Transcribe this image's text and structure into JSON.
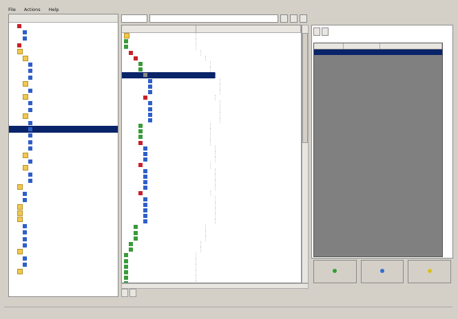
{
  "menu": [
    "File",
    "Actions",
    "Help"
  ],
  "left_header": "",
  "left_tree": [
    {
      "label": "",
      "icon": "red",
      "indent": 1
    },
    {
      "label": "",
      "icon": "blue",
      "indent": 2
    },
    {
      "label": "",
      "icon": "blue",
      "indent": 2
    },
    {
      "label": "",
      "icon": "red",
      "indent": 1
    },
    {
      "label": "",
      "icon": "folder",
      "indent": 1
    },
    {
      "label": "",
      "icon": "folder",
      "indent": 2
    },
    {
      "label": "",
      "icon": "blue",
      "indent": 3
    },
    {
      "label": "",
      "icon": "blue",
      "indent": 3
    },
    {
      "label": "",
      "icon": "blue",
      "indent": 3
    },
    {
      "label": "",
      "icon": "folder",
      "indent": 2
    },
    {
      "label": "",
      "icon": "blue",
      "indent": 3
    },
    {
      "label": "",
      "icon": "folder",
      "indent": 2
    },
    {
      "label": "",
      "icon": "blue",
      "indent": 3
    },
    {
      "label": "",
      "icon": "blue",
      "indent": 3
    },
    {
      "label": "",
      "icon": "folder",
      "indent": 2
    },
    {
      "label": "",
      "icon": "blue",
      "indent": 3
    },
    {
      "label": "",
      "icon": "blue",
      "indent": 3,
      "selected": true
    },
    {
      "label": "",
      "icon": "blue",
      "indent": 3
    },
    {
      "label": "",
      "icon": "blue",
      "indent": 3
    },
    {
      "label": "",
      "icon": "blue",
      "indent": 3
    },
    {
      "label": "",
      "icon": "folder",
      "indent": 2
    },
    {
      "label": "",
      "icon": "blue",
      "indent": 3
    },
    {
      "label": "",
      "icon": "folder",
      "indent": 2
    },
    {
      "label": "",
      "icon": "blue",
      "indent": 3
    },
    {
      "label": "",
      "icon": "blue",
      "indent": 3
    },
    {
      "label": "",
      "icon": "folder",
      "indent": 1
    },
    {
      "label": "",
      "icon": "blue",
      "indent": 2
    },
    {
      "label": "",
      "icon": "blue",
      "indent": 2
    },
    {
      "label": "",
      "icon": "folder",
      "indent": 1
    },
    {
      "label": "",
      "icon": "folder",
      "indent": 1
    },
    {
      "label": "",
      "icon": "folder",
      "indent": 1
    },
    {
      "label": "",
      "icon": "blue",
      "indent": 2
    },
    {
      "label": "",
      "icon": "blue",
      "indent": 2
    },
    {
      "label": "",
      "icon": "blue",
      "indent": 2
    },
    {
      "label": "",
      "icon": "blue",
      "indent": 2
    },
    {
      "label": "",
      "icon": "folder",
      "indent": 1
    },
    {
      "label": "",
      "icon": "blue",
      "indent": 2
    },
    {
      "label": "",
      "icon": "blue",
      "indent": 2
    },
    {
      "label": "",
      "icon": "folder",
      "indent": 1
    }
  ],
  "mid_toolbar": {
    "combo": "",
    "buttons": [
      "",
      "",
      ""
    ]
  },
  "mid_columns": [
    "",
    ""
  ],
  "mid_rows": [
    {
      "c1": "",
      "c2": "",
      "indent": 0,
      "icon": "folder"
    },
    {
      "c1": "",
      "c2": "",
      "indent": 0,
      "icon": "green"
    },
    {
      "c1": "",
      "c2": "",
      "indent": 0,
      "icon": "green"
    },
    {
      "c1": "",
      "c2": "",
      "indent": 1,
      "icon": "red"
    },
    {
      "c1": "",
      "c2": "",
      "indent": 2,
      "icon": "red"
    },
    {
      "c1": "",
      "c2": "",
      "indent": 3,
      "icon": "green"
    },
    {
      "c1": "",
      "c2": "",
      "indent": 3,
      "icon": "green"
    },
    {
      "c1": "",
      "c2": "",
      "indent": 4,
      "icon": "gray",
      "selected": true
    },
    {
      "c1": "",
      "c2": "",
      "indent": 5,
      "icon": "blue"
    },
    {
      "c1": "",
      "c2": "",
      "indent": 5,
      "icon": "blue"
    },
    {
      "c1": "",
      "c2": "",
      "indent": 5,
      "icon": "blue"
    },
    {
      "c1": "",
      "c2": "",
      "indent": 4,
      "icon": "red"
    },
    {
      "c1": "",
      "c2": "",
      "indent": 5,
      "icon": "blue"
    },
    {
      "c1": "",
      "c2": "",
      "indent": 5,
      "icon": "blue"
    },
    {
      "c1": "",
      "c2": "",
      "indent": 5,
      "icon": "blue"
    },
    {
      "c1": "",
      "c2": "",
      "indent": 5,
      "icon": "blue"
    },
    {
      "c1": "",
      "c2": "",
      "indent": 3,
      "icon": "green"
    },
    {
      "c1": "",
      "c2": "",
      "indent": 3,
      "icon": "green"
    },
    {
      "c1": "",
      "c2": "",
      "indent": 3,
      "icon": "green"
    },
    {
      "c1": "",
      "c2": "",
      "indent": 3,
      "icon": "red"
    },
    {
      "c1": "",
      "c2": "",
      "indent": 4,
      "icon": "blue"
    },
    {
      "c1": "",
      "c2": "",
      "indent": 4,
      "icon": "blue"
    },
    {
      "c1": "",
      "c2": "",
      "indent": 4,
      "icon": "blue"
    },
    {
      "c1": "",
      "c2": "",
      "indent": 3,
      "icon": "red"
    },
    {
      "c1": "",
      "c2": "",
      "indent": 4,
      "icon": "blue"
    },
    {
      "c1": "",
      "c2": "",
      "indent": 4,
      "icon": "blue"
    },
    {
      "c1": "",
      "c2": "",
      "indent": 4,
      "icon": "blue"
    },
    {
      "c1": "",
      "c2": "",
      "indent": 4,
      "icon": "blue"
    },
    {
      "c1": "",
      "c2": "",
      "indent": 3,
      "icon": "red"
    },
    {
      "c1": "",
      "c2": "",
      "indent": 4,
      "icon": "blue"
    },
    {
      "c1": "",
      "c2": "",
      "indent": 4,
      "icon": "blue"
    },
    {
      "c1": "",
      "c2": "",
      "indent": 4,
      "icon": "blue"
    },
    {
      "c1": "",
      "c2": "",
      "indent": 4,
      "icon": "blue"
    },
    {
      "c1": "",
      "c2": "",
      "indent": 4,
      "icon": "blue"
    },
    {
      "c1": "",
      "c2": "",
      "indent": 2,
      "icon": "green"
    },
    {
      "c1": "",
      "c2": "",
      "indent": 2,
      "icon": "green"
    },
    {
      "c1": "",
      "c2": "",
      "indent": 2,
      "icon": "green"
    },
    {
      "c1": "",
      "c2": "",
      "indent": 1,
      "icon": "green"
    },
    {
      "c1": "",
      "c2": "",
      "indent": 1,
      "icon": "green"
    },
    {
      "c1": "",
      "c2": "",
      "indent": 0,
      "icon": "green"
    },
    {
      "c1": "",
      "c2": "",
      "indent": 0,
      "icon": "green"
    },
    {
      "c1": "",
      "c2": "",
      "indent": 0,
      "icon": "green"
    },
    {
      "c1": "",
      "c2": "",
      "indent": 0,
      "icon": "green"
    },
    {
      "c1": "",
      "c2": "",
      "indent": 0,
      "icon": "green"
    },
    {
      "c1": "",
      "c2": "",
      "indent": 0,
      "icon": "green"
    }
  ],
  "bottom_tabs": [
    "",
    ""
  ],
  "right_tabs": [
    "",
    ""
  ],
  "right_columns": [
    "",
    "",
    ""
  ],
  "right_rows": [
    ""
  ],
  "right_buttons": [
    {
      "label": "",
      "color": "#2fa02f"
    },
    {
      "label": "",
      "color": "#2f6fd0"
    },
    {
      "label": "",
      "color": "#d8c020"
    }
  ],
  "status": {
    "left": "",
    "mid": "",
    "right": ""
  },
  "colors": {
    "selection": "#0a246a",
    "chrome": "#d4d0c8",
    "grid_bg": "#808080"
  }
}
